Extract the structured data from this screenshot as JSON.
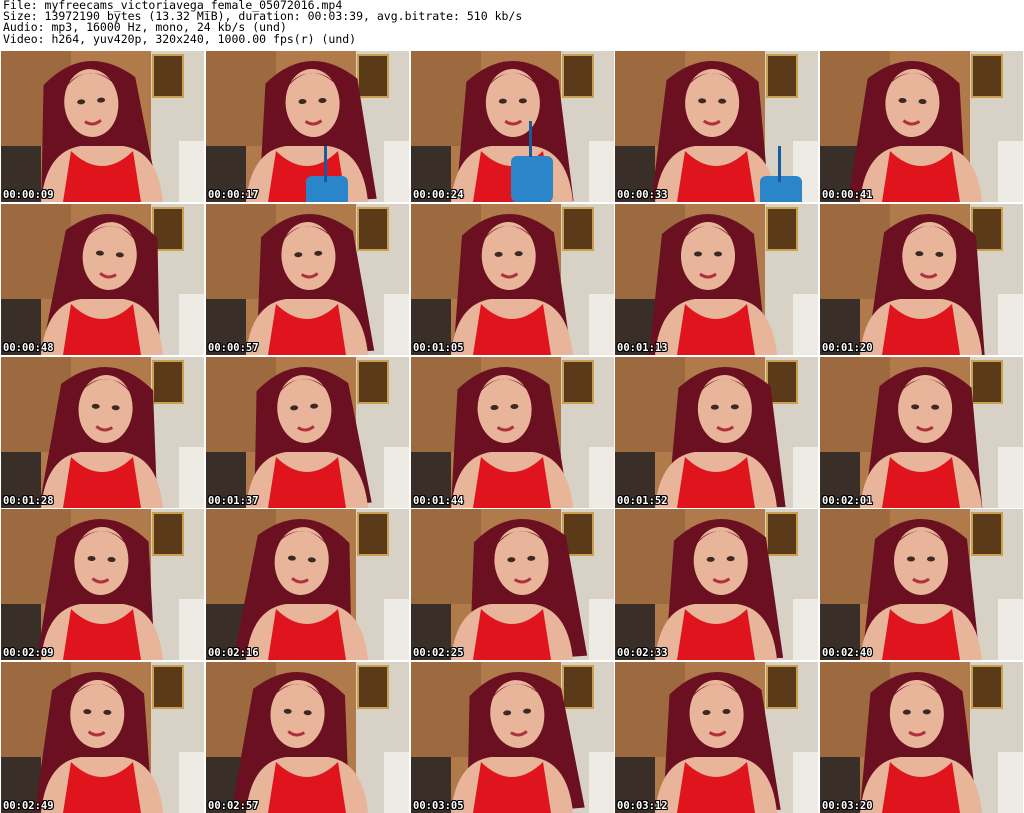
{
  "header": {
    "file": "File: myfreecams_victoriavega_female_05072016.mp4",
    "size": "Size: 13972190 bytes (13.32 MiB), duration: 00:03:39, avg.bitrate: 510 kb/s",
    "audio": "Audio: mp3, 16000 Hz, mono, 24 kb/s (und)",
    "video": "Video: h264, yuv420p, 320x240, 1000.00 fps(r) (und)"
  },
  "colors": {
    "background": "#ffffff",
    "timestamp_text": "#ffffff",
    "timestamp_outline": "#000000",
    "wall": "#b07a4a",
    "shirt": "#e0141c",
    "hair": "#6a1020",
    "skin": "#e8b49a",
    "cup": "#2a86c8"
  },
  "frames": [
    {
      "time": "00:00:09"
    },
    {
      "time": "00:00:17"
    },
    {
      "time": "00:00:24"
    },
    {
      "time": "00:00:33"
    },
    {
      "time": "00:00:41"
    },
    {
      "time": "00:00:48"
    },
    {
      "time": "00:00:57"
    },
    {
      "time": "00:01:05"
    },
    {
      "time": "00:01:13"
    },
    {
      "time": "00:01:20"
    },
    {
      "time": "00:01:28"
    },
    {
      "time": "00:01:37"
    },
    {
      "time": "00:01:44"
    },
    {
      "time": "00:01:52"
    },
    {
      "time": "00:02:01"
    },
    {
      "time": "00:02:09"
    },
    {
      "time": "00:02:16"
    },
    {
      "time": "00:02:25"
    },
    {
      "time": "00:02:33"
    },
    {
      "time": "00:02:40"
    },
    {
      "time": "00:02:49"
    },
    {
      "time": "00:02:57"
    },
    {
      "time": "00:03:05"
    },
    {
      "time": "00:03:12"
    },
    {
      "time": "00:03:20"
    }
  ]
}
